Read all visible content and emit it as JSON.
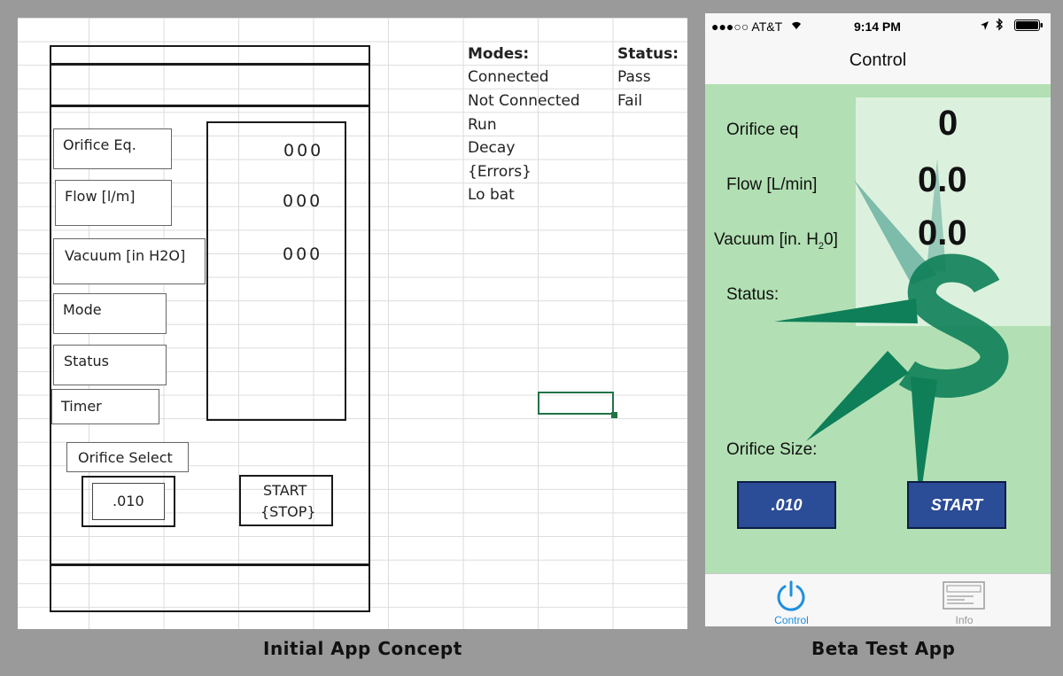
{
  "concept": {
    "caption": "Initial App Concept",
    "fields": [
      {
        "label": "Orifice Eq."
      },
      {
        "label": "Flow [l/m]"
      },
      {
        "label": "Vacuum [in H2O]"
      },
      {
        "label": "Mode"
      },
      {
        "label": "Status"
      },
      {
        "label": "Timer"
      }
    ],
    "values": [
      "000",
      "000",
      "000"
    ],
    "orifice_select_label": "Orifice Select",
    "orifice_value": ".010",
    "start_label": "START",
    "stop_label": "{STOP}",
    "modes_header": "Modes:",
    "modes": [
      "Connected",
      "Not Connected",
      "Run",
      "Decay",
      "{Errors}",
      "Lo bat"
    ],
    "status_header": "Status:",
    "statuses": [
      "Pass",
      "Fail"
    ]
  },
  "app": {
    "caption": "Beta Test App",
    "statusbar": {
      "carrier": "●●●○○ AT&T",
      "time": "9:14 PM"
    },
    "title": "Control",
    "labels": {
      "orifice_eq": "Orifice eq",
      "flow": "Flow [L/min]",
      "vacuum_prefix": "Vacuum  [in. H",
      "vacuum_sub": "2",
      "vacuum_suffix": "0]",
      "status": "Status:",
      "orifice_size": "Orifice Size:"
    },
    "values": {
      "orifice_eq": "0",
      "flow": "0.0",
      "vacuum": "0.0"
    },
    "buttons": {
      "orifice": ".010",
      "start": "START"
    },
    "tabs": [
      {
        "label": "Control",
        "icon": "power-icon",
        "active": true
      },
      {
        "label": "Info",
        "icon": "info-card-icon",
        "active": false
      }
    ],
    "colors": {
      "background": "#b2e0b4",
      "button": "#2b4c96",
      "logo_green": "#0e7f58",
      "tab_active": "#1e8fe0"
    }
  }
}
